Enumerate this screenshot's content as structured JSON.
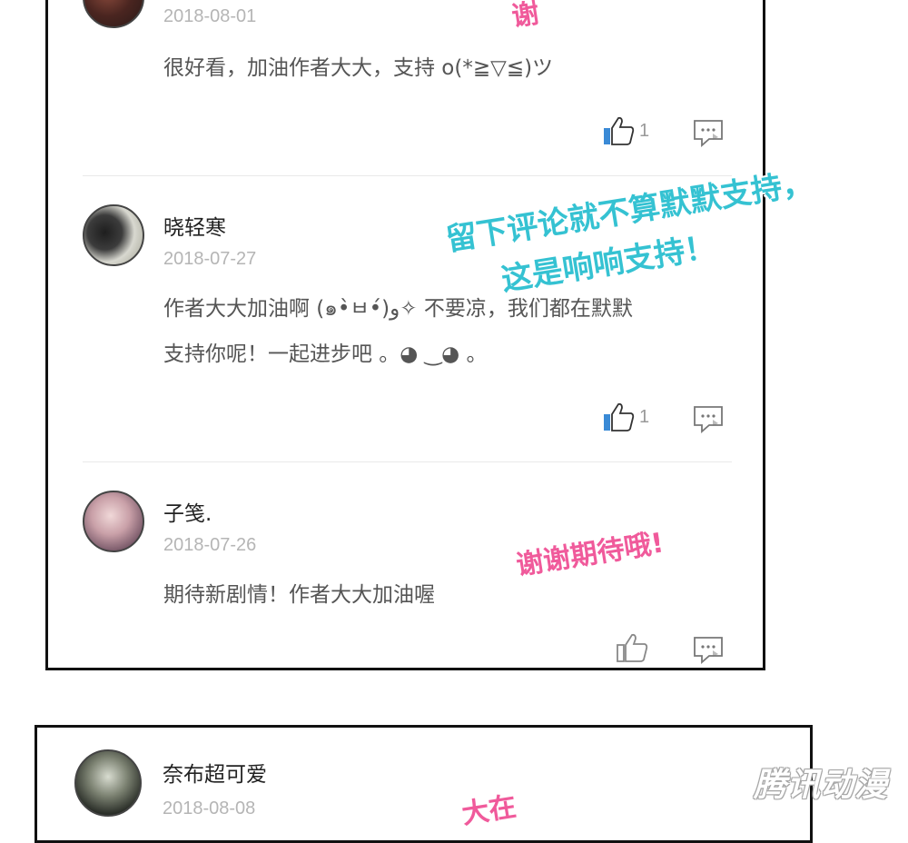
{
  "comments": [
    {
      "username": "",
      "date": "2018-08-01",
      "text_lines": [
        "很好看，加油作者大大，支持 o(*≧▽≦)ツ"
      ],
      "likes": "1"
    },
    {
      "username": "晓轻寒",
      "date": "2018-07-27",
      "text_lines": [
        "作者大大加油啊 (๑•̀ㅂ•́)و✧  不要凉，我们都在默默",
        "支持你呢！一起进步吧 。◕ ‿◕ 。"
      ],
      "likes": "1"
    },
    {
      "username": "子笺.",
      "date": "2018-07-26",
      "text_lines": [
        "期待新剧情！作者大大加油喔"
      ],
      "likes": ""
    },
    {
      "username": "奈布超可爱",
      "date": "2018-08-08"
    }
  ],
  "overlays": {
    "cyan_line1": "留下评论就不算默默支持，",
    "cyan_line2": "这是响响支持！",
    "pink_reply": "谢谢期待哦!",
    "pink_top_fragment": "谢",
    "pink_bottom_fragment": "大在"
  },
  "watermark": "腾讯动漫",
  "colors": {
    "like_blue": "#3a8ad6",
    "cyan_text": "#35c2d2",
    "pink_text": "#f05a9b"
  },
  "icons": {
    "like": "thumbs-up-icon",
    "reply": "comment-bubble-icon"
  }
}
